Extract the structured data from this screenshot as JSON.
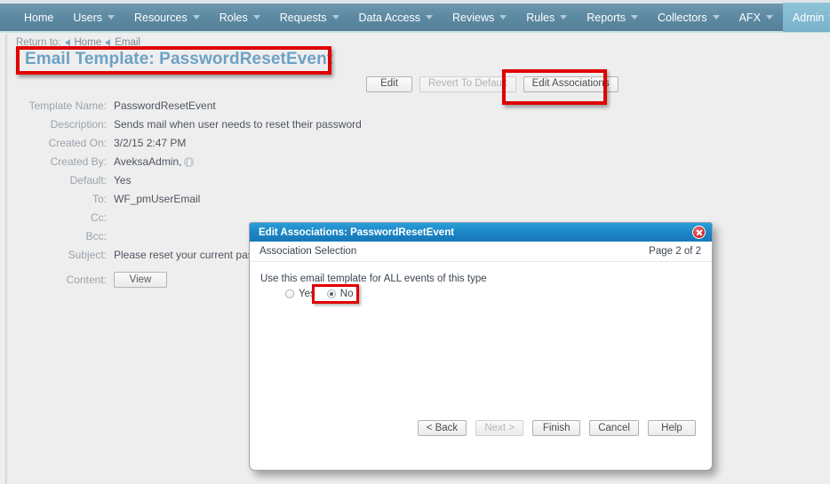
{
  "nav": {
    "items": [
      {
        "label": "Home",
        "has_caret": false,
        "active": false
      },
      {
        "label": "Users",
        "has_caret": true,
        "active": false
      },
      {
        "label": "Resources",
        "has_caret": true,
        "active": false
      },
      {
        "label": "Roles",
        "has_caret": true,
        "active": false
      },
      {
        "label": "Requests",
        "has_caret": true,
        "active": false
      },
      {
        "label": "Data Access",
        "has_caret": true,
        "active": false
      },
      {
        "label": "Reviews",
        "has_caret": true,
        "active": false
      },
      {
        "label": "Rules",
        "has_caret": true,
        "active": false
      },
      {
        "label": "Reports",
        "has_caret": true,
        "active": false
      },
      {
        "label": "Collectors",
        "has_caret": true,
        "active": false
      },
      {
        "label": "AFX",
        "has_caret": true,
        "active": false
      },
      {
        "label": "Admin",
        "has_caret": true,
        "active": true
      }
    ]
  },
  "breadcrumb": {
    "prefix": "Return to:",
    "links": [
      "Home",
      "Email"
    ]
  },
  "page": {
    "title": "Email Template: PasswordResetEvent"
  },
  "toolbar": {
    "edit_label": "Edit",
    "revert_label": "Revert To Default",
    "edit_associations_label": "Edit Associations"
  },
  "details": {
    "rows": [
      {
        "label": "Template Name:",
        "value": "PasswordResetEvent"
      },
      {
        "label": "Description:",
        "value": "Sends mail when user needs to reset their password"
      },
      {
        "label": "Created On:",
        "value": "3/2/15 2:47 PM"
      },
      {
        "label": "Created By:",
        "value": "AveksaAdmin,"
      },
      {
        "label": "Default:",
        "value": "Yes"
      },
      {
        "label": "To:",
        "value": "WF_pmUserEmail"
      },
      {
        "label": "Cc:",
        "value": ""
      },
      {
        "label": "Bcc:",
        "value": ""
      },
      {
        "label": "Subject:",
        "value": "Please reset your current password"
      }
    ],
    "content_label": "Content:",
    "content_button": "View"
  },
  "dialog": {
    "title": "Edit Associations: PasswordResetEvent",
    "section_label": "Association Selection",
    "page_indicator": "Page 2 of 2",
    "prompt": "Use this email template for ALL events of this type",
    "options": [
      {
        "label": "Yes",
        "selected": false
      },
      {
        "label": "No",
        "selected": true
      }
    ],
    "buttons": [
      {
        "label": "< Back",
        "disabled": false
      },
      {
        "label": "Next >",
        "disabled": true
      },
      {
        "label": "Finish",
        "disabled": false
      },
      {
        "label": "Cancel",
        "disabled": false
      },
      {
        "label": "Help",
        "disabled": false
      }
    ]
  },
  "annotations": {
    "color": "#e00000",
    "boxes": [
      "page-title",
      "edit-associations-button",
      "no-radio-option"
    ]
  }
}
